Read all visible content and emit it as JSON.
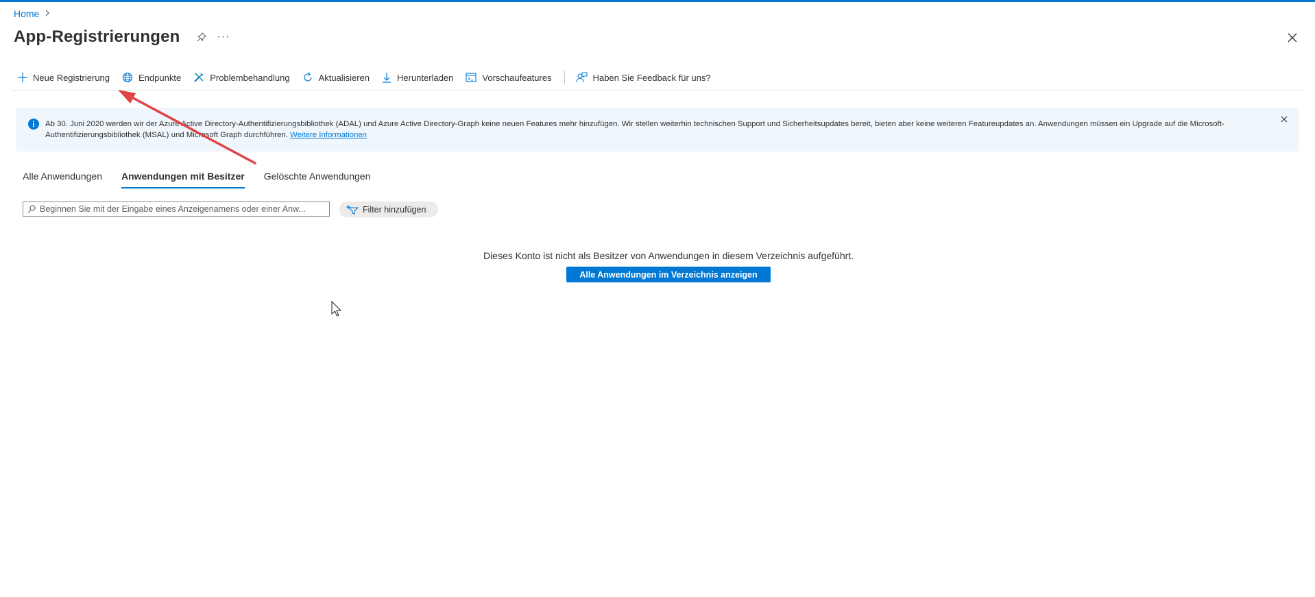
{
  "breadcrumb": {
    "home": "Home"
  },
  "page": {
    "title": "App-Registrierungen",
    "more": "···"
  },
  "toolbar": {
    "items": [
      {
        "label": "Neue Registrierung",
        "icon": "plus-icon"
      },
      {
        "label": "Endpunkte",
        "icon": "globe-icon"
      },
      {
        "label": "Problembehandlung",
        "icon": "wrench-icon"
      },
      {
        "label": "Aktualisieren",
        "icon": "refresh-icon"
      },
      {
        "label": "Herunterladen",
        "icon": "download-icon"
      },
      {
        "label": "Vorschaufeatures",
        "icon": "preview-icon"
      },
      {
        "label": "Haben Sie Feedback für uns?",
        "icon": "feedback-icon"
      }
    ]
  },
  "banner": {
    "text": "Ab 30. Juni 2020 werden wir der Azure Active Directory-Authentifizierungsbibliothek (ADAL) und Azure Active Directory-Graph keine neuen Features mehr hinzufügen. Wir stellen weiterhin technischen Support und Sicherheitsupdates bereit, bieten aber keine weiteren Featureupdates an. Anwendungen müssen ein Upgrade auf die Microsoft-Authentifizierungsbibliothek (MSAL) und Microsoft Graph durchführen.",
    "link": "Weitere Informationen"
  },
  "tabs": [
    {
      "label": "Alle Anwendungen",
      "active": false
    },
    {
      "label": "Anwendungen mit Besitzer",
      "active": true
    },
    {
      "label": "Gelöschte Anwendungen",
      "active": false
    }
  ],
  "search": {
    "placeholder": "Beginnen Sie mit der Eingabe eines Anzeigenamens oder einer Anw..."
  },
  "filter": {
    "label": "Filter hinzufügen"
  },
  "empty": {
    "message": "Dieses Konto ist nicht als Besitzer von Anwendungen in diesem Verzeichnis aufgeführt.",
    "button": "Alle Anwendungen im Verzeichnis anzeigen"
  },
  "colors": {
    "accent": "#0078d4",
    "banner_bg": "#eff6fc",
    "annotation_arrow": "#e04444"
  }
}
